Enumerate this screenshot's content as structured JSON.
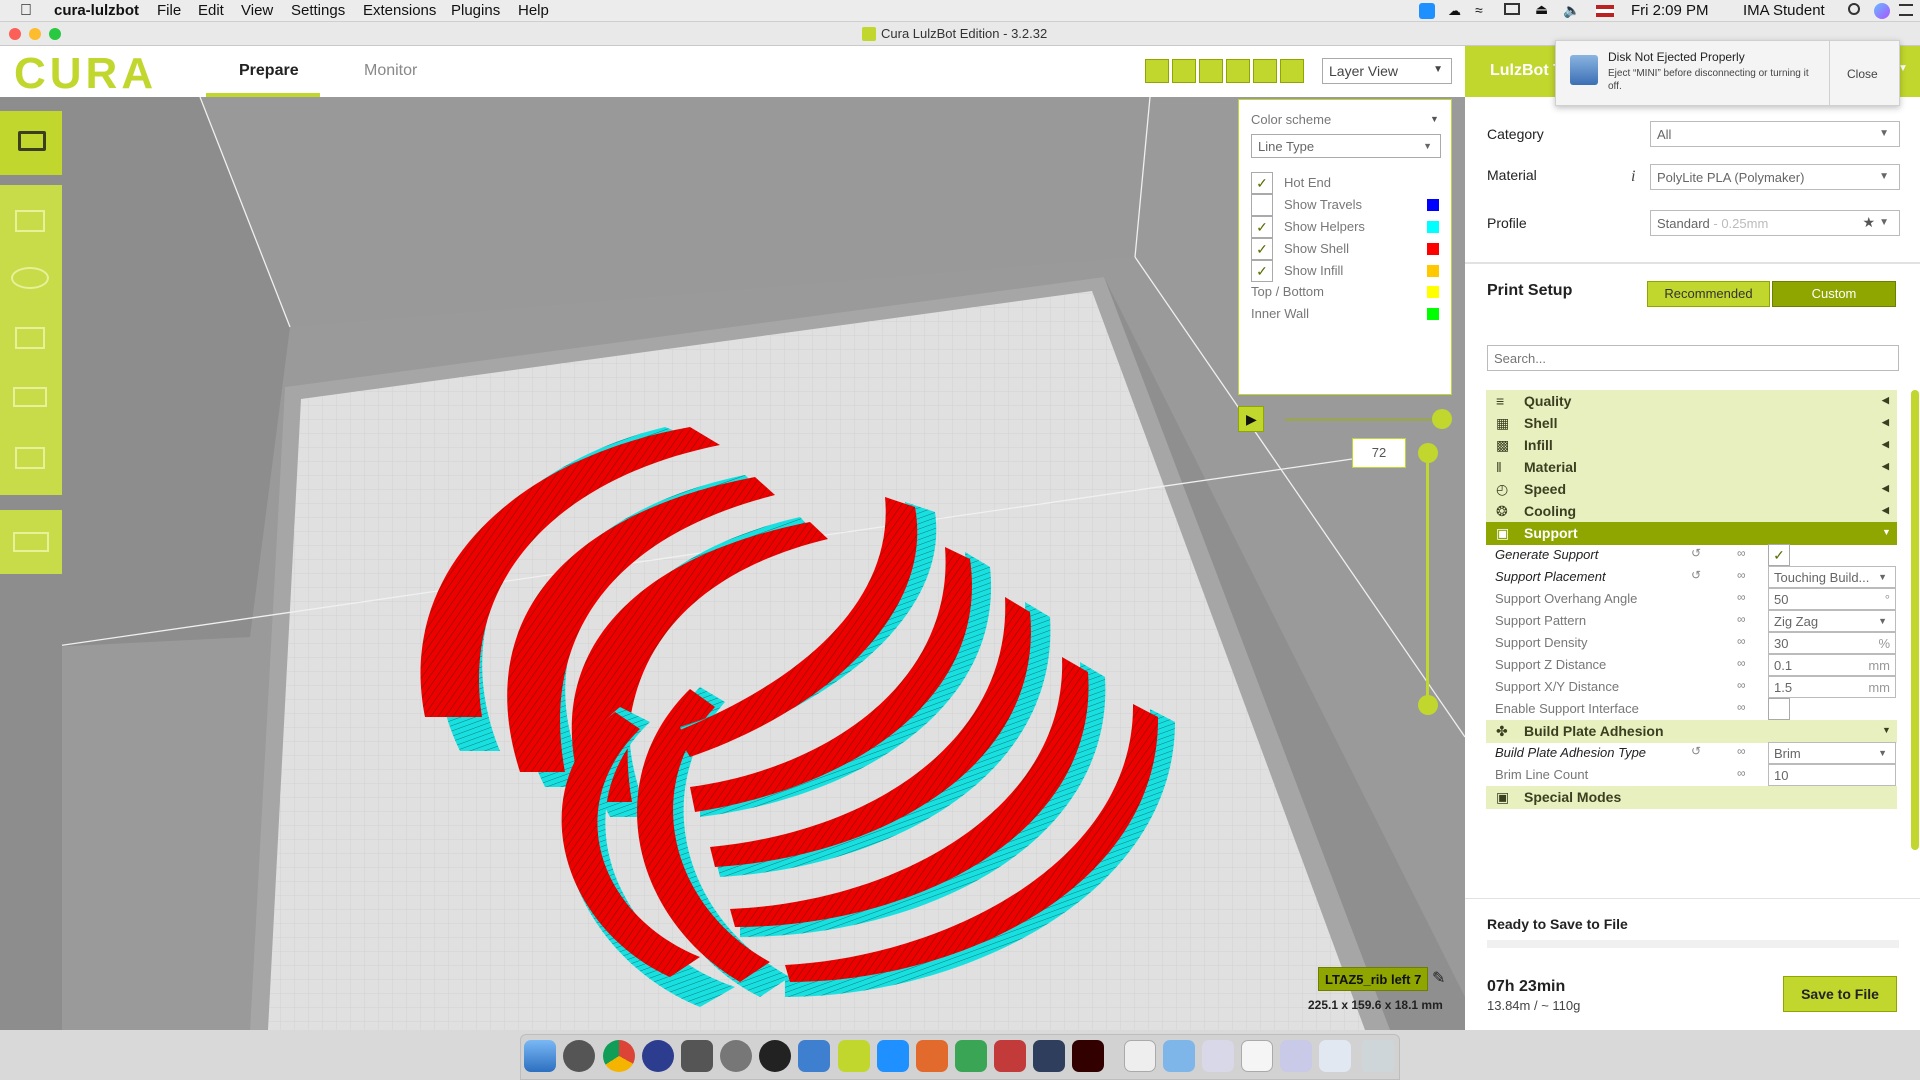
{
  "menubar": {
    "app_name": "cura-lulzbot",
    "items": [
      "File",
      "Edit",
      "View",
      "Settings",
      "Extensions",
      "Plugins",
      "Help"
    ],
    "clock": "Fri 2:09 PM",
    "user": "IMA Student"
  },
  "window": {
    "title": "Cura LulzBot Edition - 3.2.32"
  },
  "header": {
    "logo": "CURA",
    "tabs": [
      "Prepare",
      "Monitor"
    ],
    "active_tab": "Prepare",
    "view_select": "Layer View",
    "machine_label": "LulzBot T"
  },
  "notification": {
    "title": "Disk Not Ejected Properly",
    "body": "Eject “MINI” before disconnecting or turning it off.",
    "close_label": "Close"
  },
  "layer_panel": {
    "color_scheme_label": "Color scheme",
    "color_scheme_value": "Line Type",
    "items": [
      {
        "label": "Hot End",
        "checked": true,
        "color": ""
      },
      {
        "label": "Show Travels",
        "checked": false,
        "color": "#0000ff"
      },
      {
        "label": "Show Helpers",
        "checked": true,
        "color": "#00ffff"
      },
      {
        "label": "Show Shell",
        "checked": true,
        "color": "#ff0000"
      },
      {
        "label": "Show Infill",
        "checked": true,
        "color": "#ffc800"
      },
      {
        "label": "Top / Bottom",
        "checked": null,
        "color": "#ffff00"
      },
      {
        "label": "Inner Wall",
        "checked": null,
        "color": "#00ff00"
      }
    ],
    "layer_number": "72"
  },
  "object_info": {
    "name": "LTAZ5_rib left 7",
    "dimensions": "225.1 x 159.6 x 18.1 mm"
  },
  "sidebar": {
    "category_label": "Category",
    "category_value": "All",
    "material_label": "Material",
    "material_value": "PolyLite PLA (Polymaker)",
    "profile_label": "Profile",
    "profile_value": "Standard",
    "profile_suffix": "- 0.25mm",
    "print_setup_label": "Print Setup",
    "recommended_label": "Recommended",
    "custom_label": "Custom",
    "search_placeholder": "Search...",
    "sections": [
      "Quality",
      "Shell",
      "Infill",
      "Material",
      "Speed",
      "Cooling",
      "Support"
    ],
    "support_settings": [
      {
        "label": "Generate Support",
        "value": "✓",
        "kind": "check"
      },
      {
        "label": "Support Placement",
        "value": "Touching Build...",
        "kind": "select"
      },
      {
        "label": "Support Overhang Angle",
        "value": "50",
        "unit": "°",
        "kind": "text"
      },
      {
        "label": "Support Pattern",
        "value": "Zig Zag",
        "kind": "select"
      },
      {
        "label": "Support Density",
        "value": "30",
        "unit": "%",
        "kind": "text"
      },
      {
        "label": "Support Z Distance",
        "value": "0.1",
        "unit": "mm",
        "kind": "text"
      },
      {
        "label": "Support X/Y Distance",
        "value": "1.5",
        "unit": "mm",
        "kind": "text"
      },
      {
        "label": "Enable Support Interface",
        "value": "",
        "kind": "check"
      }
    ],
    "adhesion_section": "Build Plate Adhesion",
    "adhesion_settings": [
      {
        "label": "Build Plate Adhesion Type",
        "value": "Brim",
        "kind": "select"
      },
      {
        "label": "Brim Line Count",
        "value": "10",
        "kind": "text"
      }
    ],
    "special_section": "Special Modes",
    "ready_text": "Ready to Save to File",
    "print_time": "07h 23min",
    "print_usage": "13.84m / ~ 110g",
    "save_label": "Save to File"
  },
  "colors": {
    "accent": "#c1d72e",
    "accent_dark": "#8fa500",
    "shell": "#ff0000",
    "helpers": "#00ffff"
  }
}
